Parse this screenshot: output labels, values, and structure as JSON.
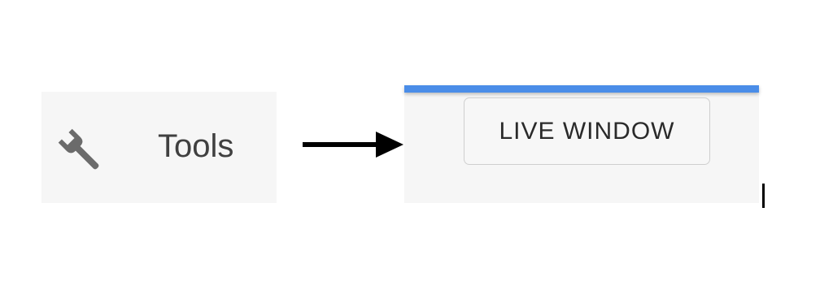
{
  "tools_menu_item": {
    "icon": "wrench-icon",
    "label": "Tools"
  },
  "arrow": {
    "icon": "right-arrow-icon"
  },
  "toolbar": {
    "accent_color": "#4a8de8",
    "live_window_button_label": "LIVE WINDOW"
  },
  "cursor": {
    "icon": "text-cursor"
  }
}
